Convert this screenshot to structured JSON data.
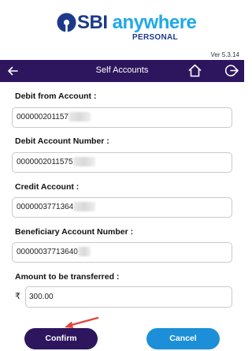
{
  "brand": {
    "name_part1": "SBI",
    "name_part2": " anywhere",
    "subtitle": "PERSONAL",
    "version": "Ver 5.3.14",
    "primary_color": "#1d3a8a",
    "accent_color": "#1fa9e6"
  },
  "navbar": {
    "title": "Self Accounts",
    "back_icon": "arrow-left-icon",
    "home_icon": "home-icon",
    "logout_icon": "logout-icon",
    "background": "#2d165e"
  },
  "form": {
    "debit_from_account": {
      "label": "Debit from Account :",
      "value": "000000201157"
    },
    "debit_account_number": {
      "label": "Debit Account Number :",
      "value": "0000002011575"
    },
    "credit_account": {
      "label": "Credit Account :",
      "value": "0000003771364"
    },
    "beneficiary_account_number": {
      "label": "Beneficiary Account Number :",
      "value": "00000037713640"
    },
    "amount": {
      "label": "Amount to be transferred :",
      "currency_symbol": "₹",
      "value": "300.00"
    }
  },
  "buttons": {
    "confirm_label": "Confirm",
    "cancel_label": "Cancel",
    "confirm_color": "#2d165e",
    "cancel_color": "#1c8fd8"
  },
  "annotation": {
    "arrow_color": "#e2453c"
  }
}
